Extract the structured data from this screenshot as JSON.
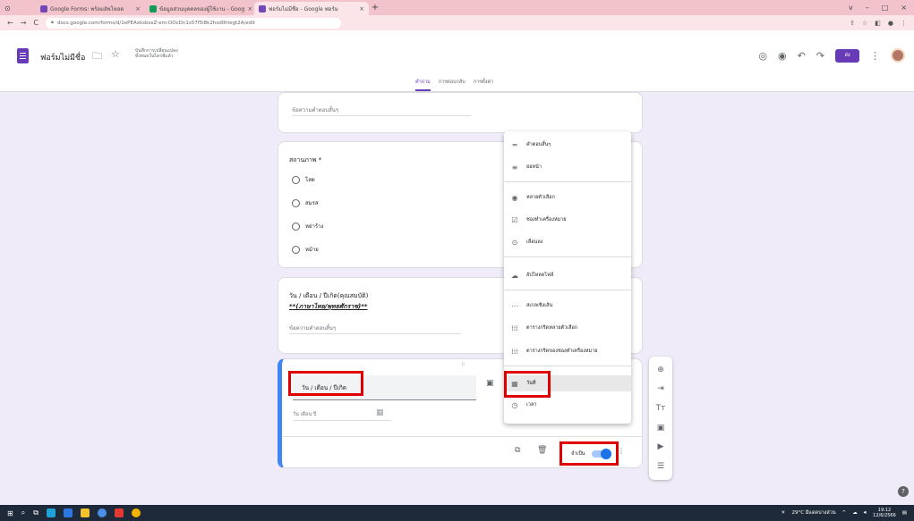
{
  "browser": {
    "tabs": [
      {
        "label": "Google Forms: พร้อมอัพโหลด"
      },
      {
        "label": "ข้อมูลส่วนบุคคลของผู้ใช้งาน - Goog"
      },
      {
        "label": "ฟอร์มไม่มีชื่อ - Google ฟอร์ม"
      }
    ],
    "url": "docs.google.com/forms/d/1ePEAxksbsxZ-em-DOcDn1s57f5i8k2hsd0hlegt2A/edit",
    "window_controls": [
      "v",
      "–",
      "□",
      "×"
    ]
  },
  "header": {
    "form_title": "ฟอร์มไม่มีชื่อ",
    "saved_note": "บันทึกการเปลี่ยนแปลงทั้งหมดในไดรฟ์แล้ว",
    "send_label": "ส่ง",
    "tabs": [
      "คำถาม",
      "การตอบกลับ",
      "การตั้งค่า"
    ]
  },
  "cards": {
    "top_placeholder": "ข้อความคำตอบสั้นๆ",
    "gender": {
      "title": "สถานภาพ *",
      "options": [
        "โสด",
        "สมรส",
        "หย่าร้าง",
        "หม้าย"
      ]
    },
    "birth": {
      "title": "วัน / เดือน / ปีเกิด(คุณสมบัติ)",
      "subtitle": "**(ภาษาไทย/พุทธศักราช)**",
      "placeholder": "ข้อความคำตอบสั้นๆ"
    },
    "active": {
      "question": "วัน / เดือน / ปีเกิด",
      "date_placeholder": "วัน เดือน ปี",
      "required_label": "จำเป็น"
    }
  },
  "type_menu": {
    "items": [
      {
        "label": "คำตอบสั้นๆ",
        "icon": "short-answer-icon"
      },
      {
        "label": "ย่อหน้า",
        "icon": "paragraph-icon"
      },
      {
        "label": "หลายตัวเลือก",
        "icon": "radio-icon"
      },
      {
        "label": "ช่องทำเครื่องหมาย",
        "icon": "checkbox-icon"
      },
      {
        "label": "เลื่อนลง",
        "icon": "dropdown-icon"
      },
      {
        "label": "อัปโหลดไฟล์",
        "icon": "upload-icon"
      },
      {
        "label": "สเกลเชิงเส้น",
        "icon": "linear-scale-icon"
      },
      {
        "label": "ตารางกริดหลายตัวเลือก",
        "icon": "grid-icon"
      },
      {
        "label": "ตารางกริดของช่องทำเครื่องหมาย",
        "icon": "grid-check-icon"
      },
      {
        "label": "วันที่",
        "icon": "calendar-icon"
      },
      {
        "label": "เวลา",
        "icon": "clock-icon"
      }
    ]
  },
  "taskbar": {
    "weather": "29°C มีแดดบางส่วน",
    "time": "19:12",
    "date": "12/6/2566"
  },
  "colors": {
    "accent": "#673ab7",
    "annotation": "#e00000",
    "toggle": "#1a73e8"
  }
}
